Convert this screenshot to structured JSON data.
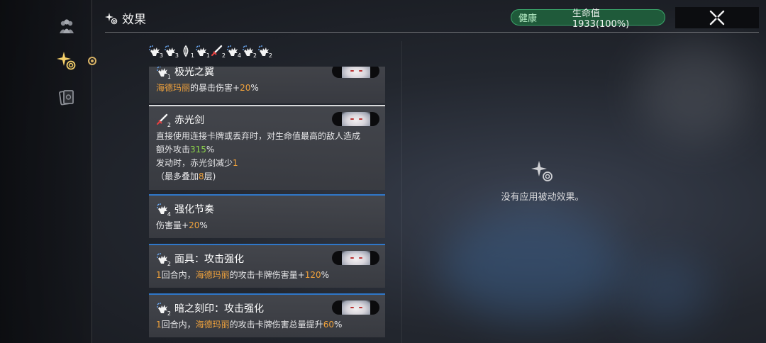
{
  "header": {
    "title": "效果"
  },
  "health": {
    "status": "健康",
    "hp_text": "生命值 1933(100%)"
  },
  "rail": {
    "items": [
      "party-icon",
      "effects-icon",
      "cards-icon"
    ]
  },
  "stacks": [
    {
      "icon": "fist-burst-icon",
      "n": "3"
    },
    {
      "icon": "fist-burst-icon",
      "n": "3"
    },
    {
      "icon": "wing-icon",
      "n": "1"
    },
    {
      "icon": "fist-burst-icon",
      "n": "1"
    },
    {
      "icon": "red-sword-icon",
      "n": "2"
    },
    {
      "icon": "fist-burst-icon",
      "n": "4"
    },
    {
      "icon": "fist-burst-icon",
      "n": "2"
    },
    {
      "icon": "fist-burst-icon",
      "n": "2"
    }
  ],
  "cards": [
    {
      "title": "极光之翼",
      "icon_n": "1",
      "lines": [
        [
          {
            "t": "海德玛丽",
            "c": "o"
          },
          {
            "t": "的暴击伤害+"
          },
          {
            "t": "20",
            "c": "o"
          },
          {
            "t": "%"
          }
        ]
      ]
    },
    {
      "title": "赤光剑",
      "icon_n": "2",
      "lines": [
        [
          {
            "t": "直接使用连接卡牌或丢弃时，对生命值最高的敌人造成"
          }
        ],
        [
          {
            "t": "额外攻击"
          },
          {
            "t": "315",
            "c": "g"
          },
          {
            "t": "%"
          }
        ],
        [
          {
            "t": "发动时，赤光剑减少"
          },
          {
            "t": "1",
            "c": "o"
          }
        ],
        [
          {
            "t": "（最多叠加"
          },
          {
            "t": "8",
            "c": "o"
          },
          {
            "t": "层)"
          }
        ]
      ]
    },
    {
      "title": "强化节奏",
      "icon_n": "4",
      "lines": [
        [
          {
            "t": "伤害量+"
          },
          {
            "t": "20",
            "c": "o"
          },
          {
            "t": "%"
          }
        ]
      ]
    },
    {
      "title": "面具：攻击强化",
      "icon_n": "2",
      "lines": [
        [
          {
            "t": "1",
            "c": "o"
          },
          {
            "t": "回合内，"
          },
          {
            "t": "海德玛丽",
            "c": "o"
          },
          {
            "t": "的攻击卡牌伤害量+"
          },
          {
            "t": "120",
            "c": "o"
          },
          {
            "t": "%"
          }
        ]
      ]
    },
    {
      "title": "暗之刻印：攻击强化",
      "icon_n": "2",
      "lines": [
        [
          {
            "t": "1",
            "c": "o"
          },
          {
            "t": "回合内，"
          },
          {
            "t": "海德玛丽",
            "c": "o"
          },
          {
            "t": "的攻击卡牌伤害总量提升"
          },
          {
            "t": "60",
            "c": "o"
          },
          {
            "t": "%"
          }
        ]
      ]
    }
  ],
  "passive": {
    "empty_text": "没有应用被动效果。"
  },
  "colors": {
    "accent_orange": "#f0a23c",
    "accent_green": "#8bd24a",
    "health_green": "#1f5a3a",
    "border_blue": "#2f77c9",
    "gold": "#d7b265"
  }
}
